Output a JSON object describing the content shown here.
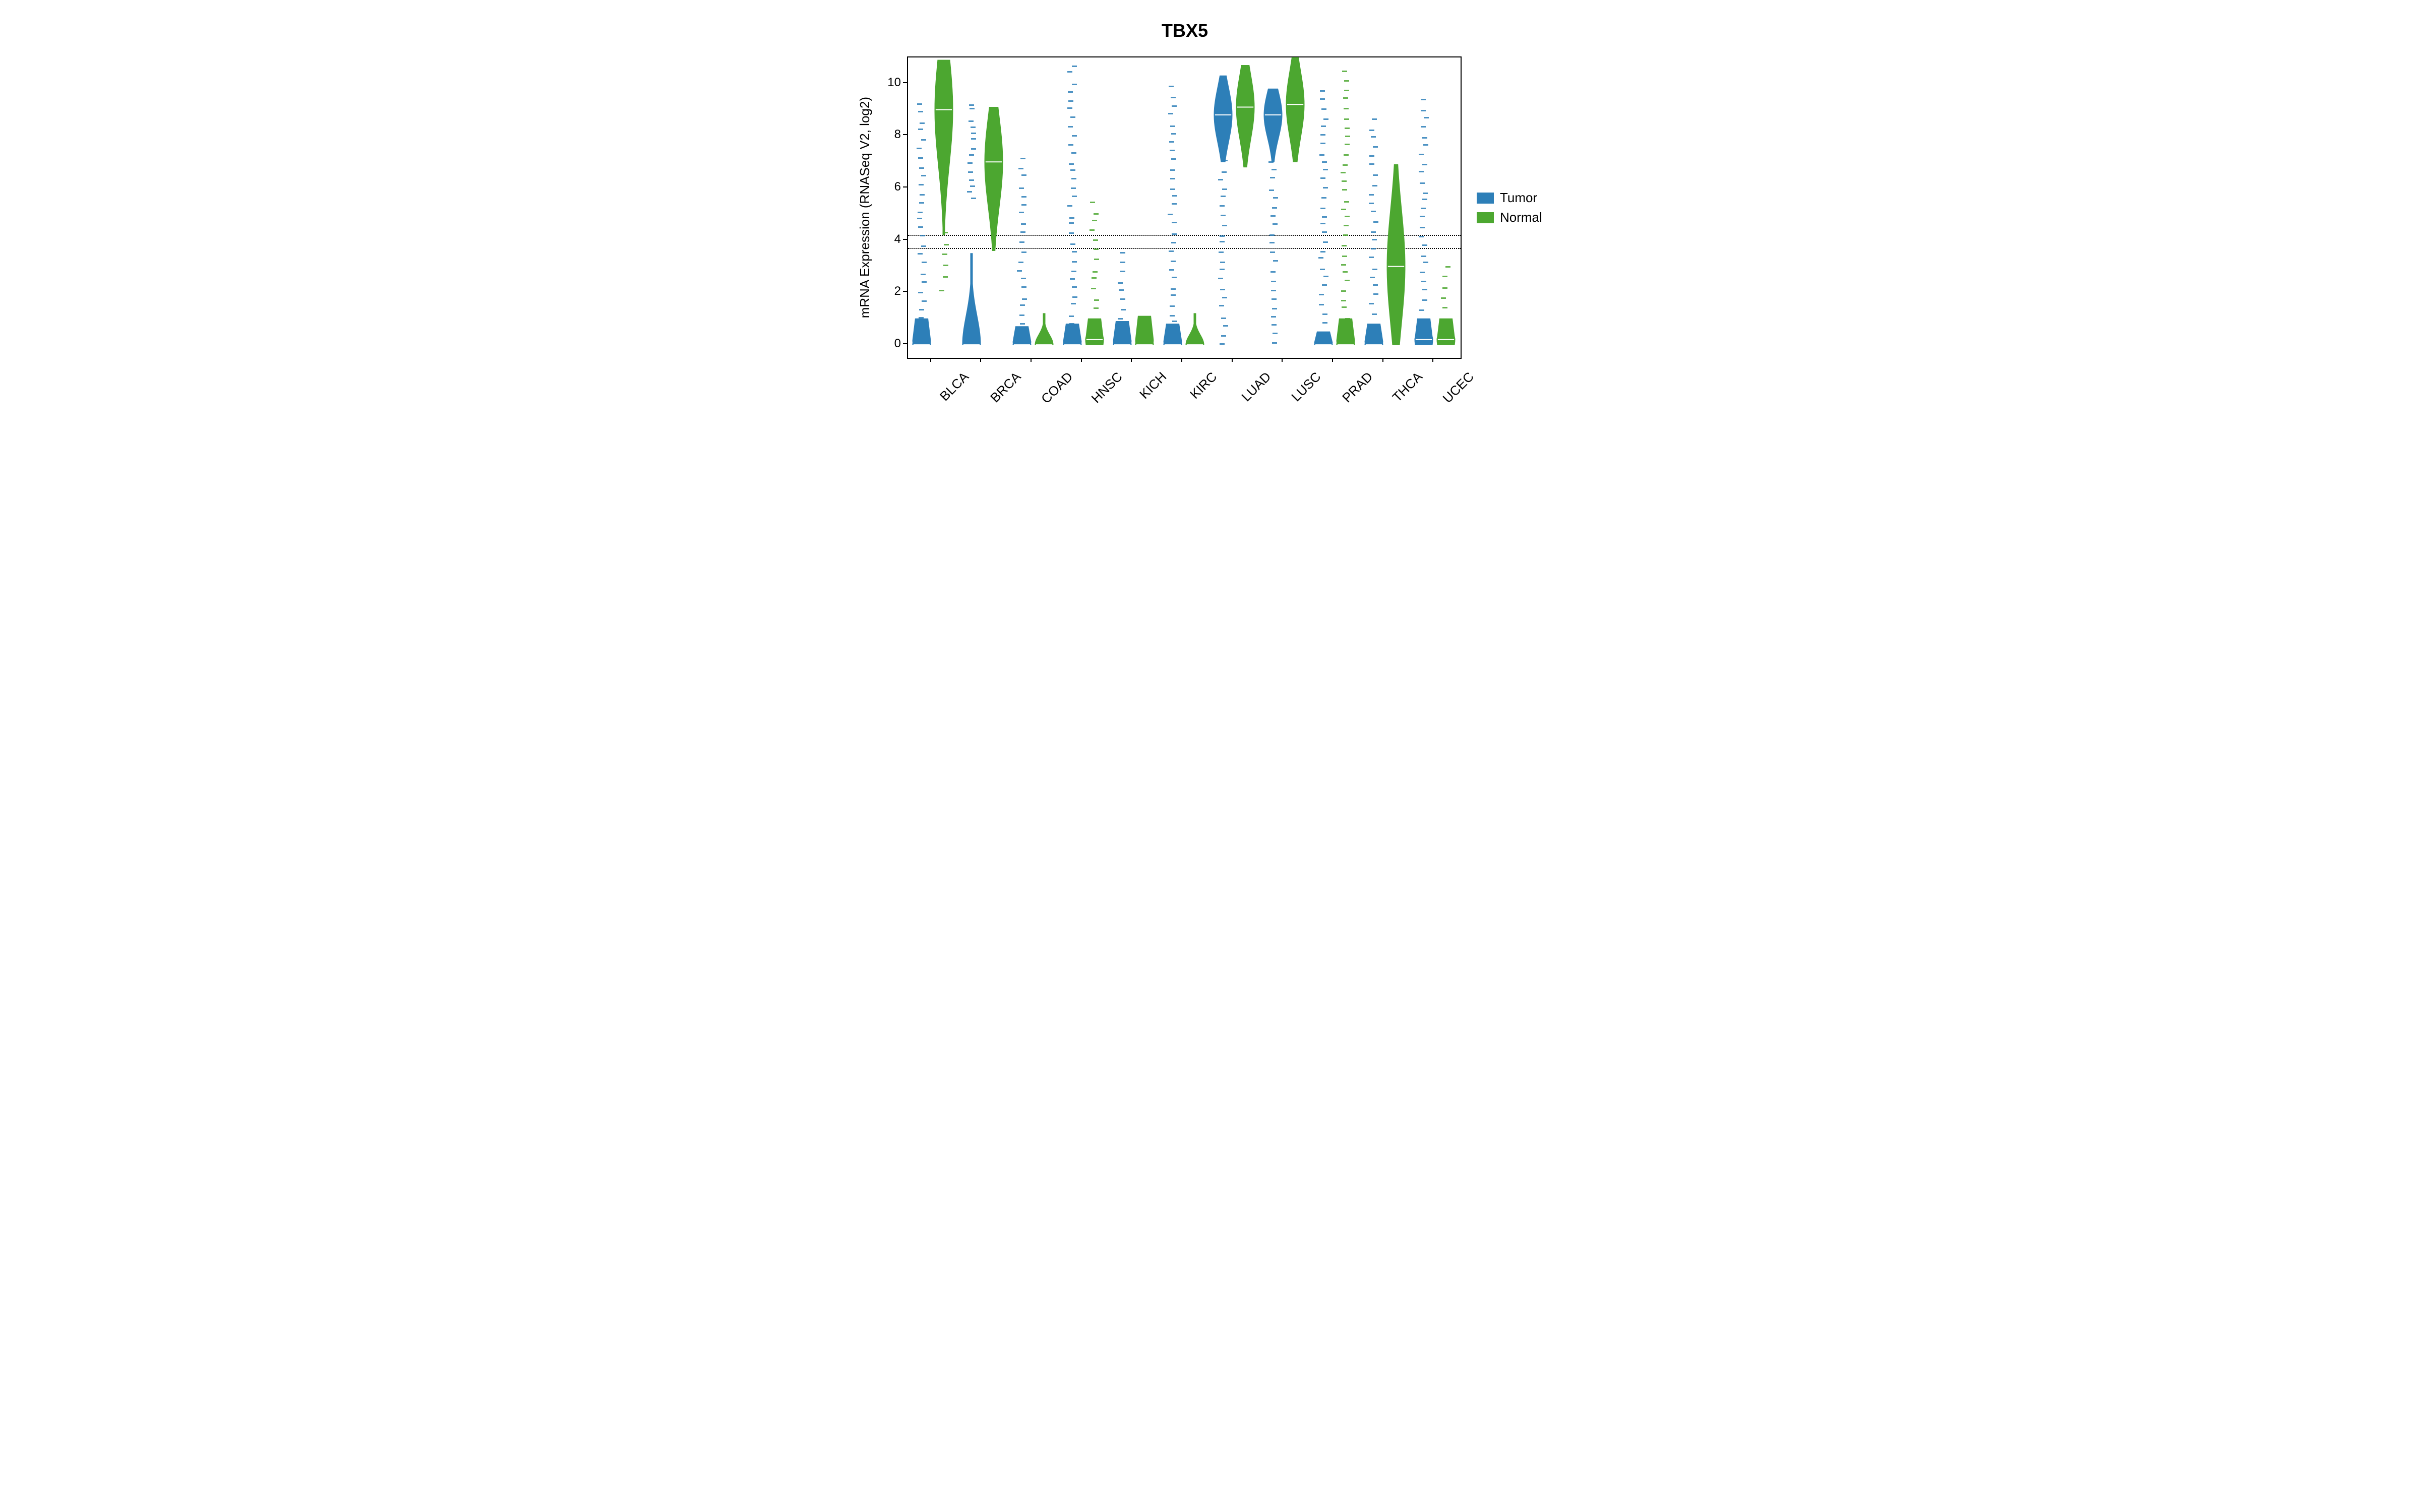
{
  "chart_data": {
    "type": "violin",
    "title": "TBX5",
    "ylabel": "mRNA Expression (RNASeq V2, log2)",
    "xlabel": "",
    "ylim": [
      -0.5,
      11
    ],
    "yticks": [
      0,
      2,
      4,
      6,
      8,
      10
    ],
    "reference_lines": [
      3.7,
      4.2
    ],
    "categories": [
      "BLCA",
      "BRCA",
      "COAD",
      "HNSC",
      "KICH",
      "KIRC",
      "LUAD",
      "LUSC",
      "PRAD",
      "THCA",
      "UCEC"
    ],
    "series": [
      {
        "name": "Tumor",
        "color": "#2d7fb8",
        "summary_per_category": {
          "BLCA": {
            "median": 0.0,
            "bulk_range": [
              0,
              1.0
            ],
            "outliers_to": 9.2
          },
          "BRCA": {
            "median": 0.0,
            "bulk_range": [
              0,
              3.5
            ],
            "secondary_cluster": [
              5.5,
              9.2
            ]
          },
          "COAD": {
            "median": 0.0,
            "bulk_range": [
              0,
              0.7
            ],
            "outliers_to": 7.1
          },
          "HNSC": {
            "median": 0.0,
            "bulk_range": [
              0,
              0.8
            ],
            "outliers_to": 10.7
          },
          "KICH": {
            "median": 0.0,
            "bulk_range": [
              0,
              0.9
            ],
            "outliers_to": 3.5
          },
          "KIRC": {
            "median": 0.0,
            "bulk_range": [
              0,
              0.8
            ],
            "outliers_to": 9.8
          },
          "LUAD": {
            "median": 8.8,
            "bulk_range": [
              7.0,
              10.3
            ],
            "outliers_to": 0.0
          },
          "LUSC": {
            "median": 8.8,
            "bulk_range": [
              7.0,
              9.8
            ],
            "outliers_to": 0.0
          },
          "PRAD": {
            "median": 0.0,
            "bulk_range": [
              0,
              0.5
            ],
            "outliers_to": 9.7
          },
          "THCA": {
            "median": 0.0,
            "bulk_range": [
              0,
              0.8
            ],
            "outliers_to": 8.6
          },
          "UCEC": {
            "median": 0.2,
            "bulk_range": [
              0,
              1.0
            ],
            "outliers_to": 9.3
          }
        }
      },
      {
        "name": "Normal",
        "color": "#4ca730",
        "summary_per_category": {
          "BLCA": {
            "median": 9.0,
            "bulk_range": [
              4.2,
              10.9
            ],
            "outliers_to": 2.1
          },
          "BRCA": {
            "median": 7.0,
            "bulk_range": [
              3.6,
              9.1
            ]
          },
          "COAD": {
            "median": 0.0,
            "bulk_range": [
              0,
              1.2
            ]
          },
          "HNSC": {
            "median": 0.2,
            "bulk_range": [
              0,
              1.0
            ],
            "outliers_to": 5.4
          },
          "KICH": {
            "median": 0.0,
            "bulk_range": [
              0,
              1.1
            ]
          },
          "KIRC": {
            "median": 0.0,
            "bulk_range": [
              0,
              1.2
            ]
          },
          "LUAD": {
            "median": 9.1,
            "bulk_range": [
              6.8,
              10.7
            ]
          },
          "LUSC": {
            "median": 9.2,
            "bulk_range": [
              7.0,
              11.0
            ]
          },
          "PRAD": {
            "median": 0.0,
            "bulk_range": [
              0,
              1.0
            ],
            "outliers_to": 10.4
          },
          "THCA": {
            "median": 3.0,
            "bulk_range": [
              0,
              6.9
            ]
          },
          "UCEC": {
            "median": 0.2,
            "bulk_range": [
              0,
              1.0
            ],
            "outliers_to": 2.9
          }
        }
      }
    ],
    "legend": [
      "Tumor",
      "Normal"
    ],
    "colors": {
      "Tumor": "#2d7fb8",
      "Normal": "#4ca730"
    }
  }
}
